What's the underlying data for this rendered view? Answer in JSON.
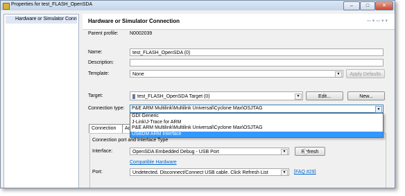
{
  "window": {
    "title": "Properties for test_FLASH_OpenSDA",
    "minimize": "–",
    "maximize": "□",
    "close": "✕"
  },
  "left_panel": {
    "selected_item": "Hardware or Simulator Conn"
  },
  "header": {
    "title": "Hardware or Simulator Connection",
    "nav_arrows": "⇦ ▾ ⇨ ▾ ▾"
  },
  "form": {
    "parent_profile_label": "Parent profile:",
    "parent_profile_value": "N0002039",
    "name_label": "Name:",
    "name_value": "test_FLASH_OpenSDA (0)",
    "description_label": "Description:",
    "description_value": "",
    "template_label": "Template:",
    "template_value": "None",
    "apply_defaults": "Apply Defaults",
    "target_label": "Target:",
    "target_value": "test_FLASH_OpenSDA Target (0)",
    "edit_button": "Edit...",
    "new_button": "New...",
    "connection_type_label": "Connection type:",
    "connection_type_value": "P&E ARM Multilink\\Multilink Universal\\Cyclone Max\\OSJTAG"
  },
  "dropdown": {
    "options": [
      "GDI Generic",
      "J-Link\\J-Trace for ARM",
      "P&E ARM Multilink\\Multilink Universal\\Cyclone Max\\OSJTAG",
      "USBDM ARM Interface"
    ],
    "highlighted": 3
  },
  "tabs": [
    "Connection",
    "Ad"
  ],
  "group": {
    "title": "Connection port and Interface Type",
    "interface_label": "Interface:",
    "interface_value": "OpenSDA Embedded Debug - USB Port",
    "refresh_button": "Refresh",
    "compatible_hardware": "Compatible Hardware",
    "port_label": "Port:",
    "port_value": "Undetected. Disconnect/Connect USB cable. Click Refresh List",
    "faq_link": "[FAQ #29]"
  }
}
